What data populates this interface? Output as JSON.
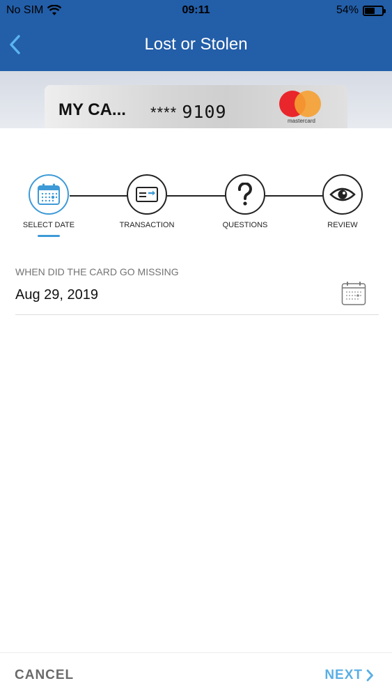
{
  "status_bar": {
    "carrier": "No SIM",
    "time": "09:11",
    "battery": "54%",
    "battery_level": 0.54
  },
  "header": {
    "title": "Lost or Stolen"
  },
  "card": {
    "name": "MY CA...",
    "masked": "****",
    "last4": "9109",
    "network": "mastercard"
  },
  "stepper": {
    "active_index": 0,
    "steps": [
      {
        "label": "SELECT DATE",
        "icon": "calendar-icon"
      },
      {
        "label": "TRANSACTION",
        "icon": "card-transfer-icon"
      },
      {
        "label": "QUESTIONS",
        "icon": "question-icon"
      },
      {
        "label": "REVIEW",
        "icon": "eye-icon"
      }
    ]
  },
  "date_field": {
    "label": "WHEN DID THE CARD GO MISSING",
    "value": "Aug 29, 2019",
    "icon": "calendar-icon"
  },
  "footer": {
    "cancel_label": "CANCEL",
    "next_label": "NEXT"
  },
  "colors": {
    "header": "#235ea8",
    "accent": "#3d9ad7",
    "next": "#5aafe4",
    "cancel": "#6a6a6a"
  }
}
